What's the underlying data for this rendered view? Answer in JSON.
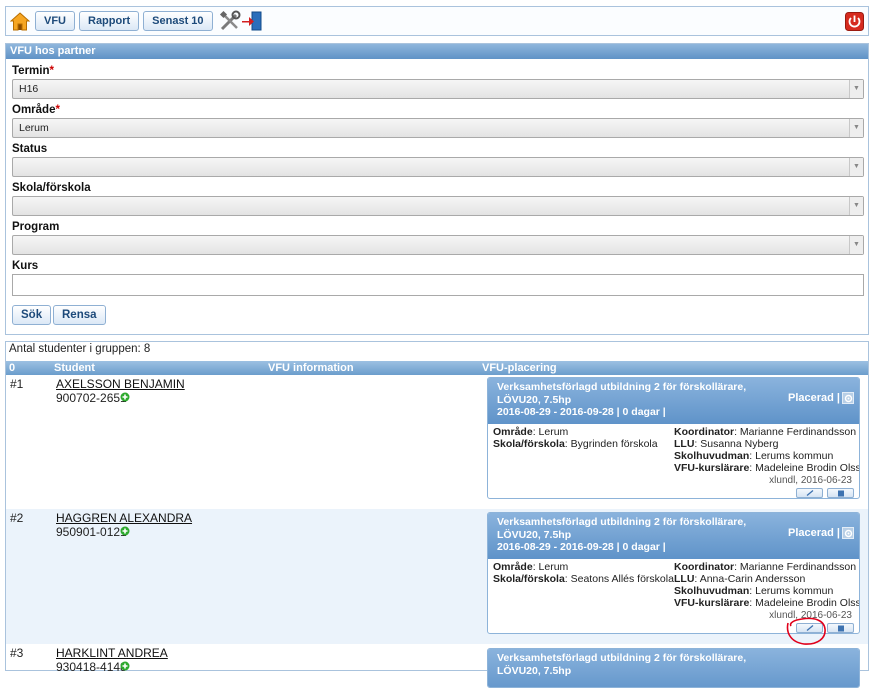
{
  "toolbar": {
    "home_icon": "home-icon",
    "buttons": [
      "VFU",
      "Rapport",
      "Senast 10"
    ],
    "tools_icon": "tools-icon",
    "exit_icon": "exit-door-icon",
    "power_icon": "power-icon"
  },
  "search": {
    "title": "VFU hos partner",
    "termin_label": "Termin",
    "termin_value": "H16",
    "omrade_label": "Område",
    "omrade_value": "Lerum",
    "status_label": "Status",
    "status_value": "",
    "skola_label": "Skola/förskola",
    "skola_value": "",
    "program_label": "Program",
    "program_value": "",
    "kurs_label": "Kurs",
    "kurs_value": "",
    "required_mark": "*",
    "sok_label": "Sök",
    "rensa_label": "Rensa"
  },
  "results": {
    "count_text": "Antal studenter i gruppen: 8",
    "col_zero": "0",
    "col_student": "Student",
    "col_info": "VFU information",
    "col_placering": "VFU-placering",
    "rows": [
      {
        "num": "#1",
        "name": "AXELSSON BENJAMIN",
        "pnr": "900702-2651",
        "course_line1": "Verksamhetsförlagd utbildning 2 för förskollärare,",
        "course_line2": "LÖVU20, 7.5hp",
        "dates": "2016-08-29 - 2016-09-28 | 0 dagar |",
        "status": "Placerad |",
        "omrade_label": "Område",
        "omrade": "Lerum",
        "skola_label": "Skola/förskola",
        "skola": "Bygrinden förskola",
        "koord_label": "Koordinator",
        "koord": "Marianne Ferdinandsson",
        "llu_label": "LLU",
        "llu": "Susanna Nyberg",
        "huvudman_label": "Skolhuvudman",
        "huvudman": "Lerums kommun",
        "larare_label": "VFU-kurslärare",
        "larare": "Madeleine Brodin Olsson",
        "stamp": "xlundl, 2016-06-23"
      },
      {
        "num": "#2",
        "name": "HAGGREN ALEXANDRA",
        "pnr": "950901-0121",
        "course_line1": "Verksamhetsförlagd utbildning 2 för förskollärare,",
        "course_line2": "LÖVU20, 7.5hp",
        "dates": "2016-08-29 - 2016-09-28 | 0 dagar |",
        "status": "Placerad |",
        "omrade_label": "Område",
        "omrade": "Lerum",
        "skola_label": "Skola/förskola",
        "skola": "Seatons Allés förskola",
        "koord_label": "Koordinator",
        "koord": "Marianne Ferdinandsson",
        "llu_label": "LLU",
        "llu": "Anna-Carin Andersson",
        "huvudman_label": "Skolhuvudman",
        "huvudman": "Lerums kommun",
        "larare_label": "VFU-kurslärare",
        "larare": "Madeleine Brodin Olsson",
        "stamp": "xlundl, 2016-06-23"
      },
      {
        "num": "#3",
        "name": "HARKLINT ANDREA",
        "pnr": "930418-4148",
        "course_line1": "Verksamhetsförlagd utbildning 2 för förskollärare,",
        "course_line2": "LÖVU20, 7.5hp"
      }
    ]
  },
  "colors": {
    "header_blue": "#5f93c9",
    "border_blue": "#aac3dd",
    "alt_row": "#ebf3fb",
    "annotation_red": "#e0001b",
    "required_red": "#cc0000"
  }
}
